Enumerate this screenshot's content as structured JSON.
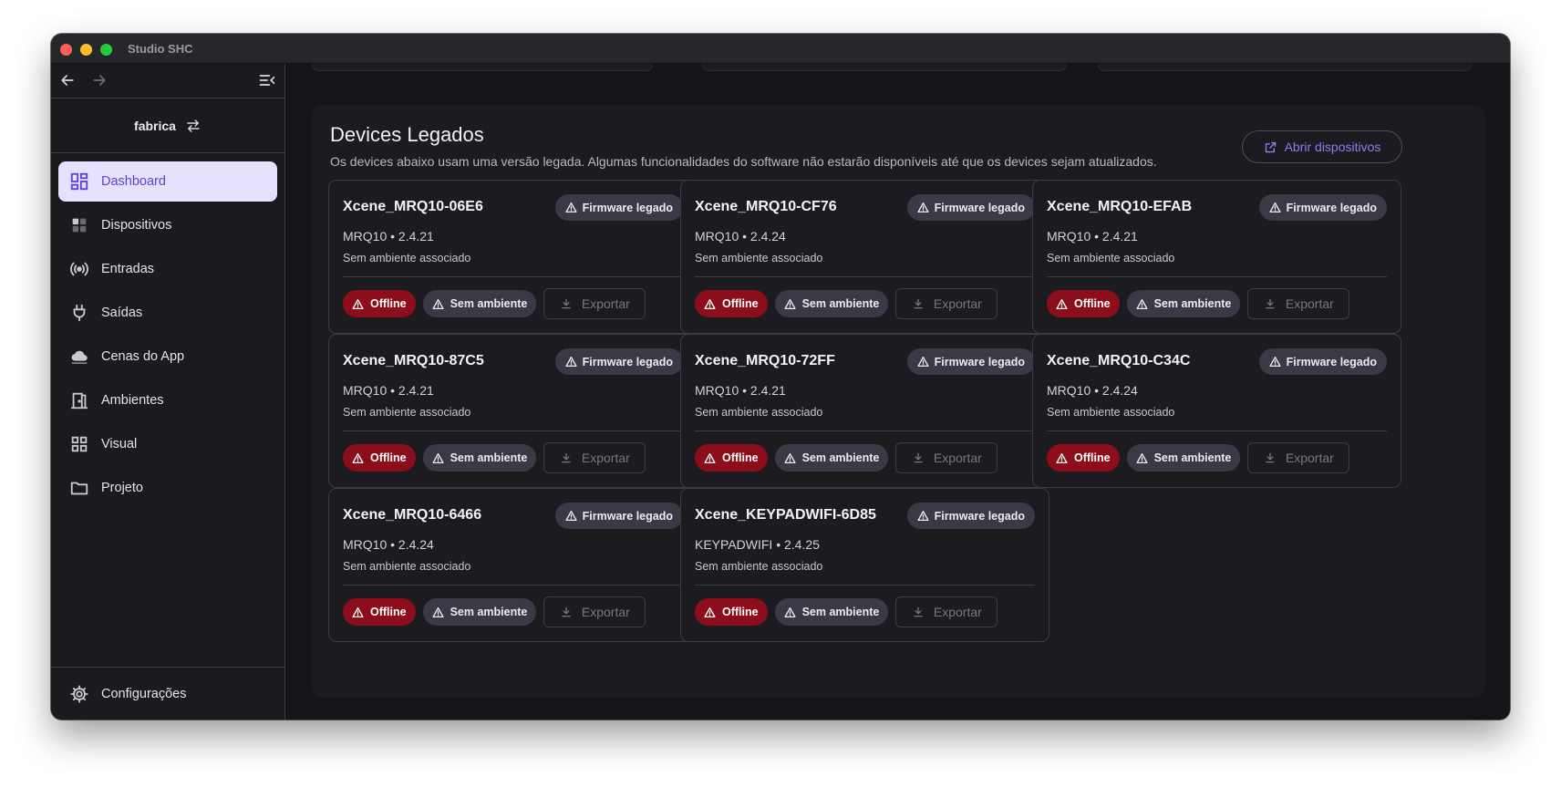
{
  "window": {
    "title": "Studio SHC"
  },
  "sidebar": {
    "project_name": "fabrica",
    "items": [
      {
        "label": "Dashboard",
        "icon": "dashboard-icon",
        "active": true
      },
      {
        "label": "Dispositivos",
        "icon": "devices-icon",
        "active": false
      },
      {
        "label": "Entradas",
        "icon": "broadcast-icon",
        "active": false
      },
      {
        "label": "Saídas",
        "icon": "plug-icon",
        "active": false
      },
      {
        "label": "Cenas do App",
        "icon": "cloud-icon",
        "active": false
      },
      {
        "label": "Ambientes",
        "icon": "door-icon",
        "active": false
      },
      {
        "label": "Visual",
        "icon": "grid-icon",
        "active": false
      },
      {
        "label": "Projeto",
        "icon": "folder-icon",
        "active": false
      }
    ],
    "settings_label": "Configurações"
  },
  "panel": {
    "title": "Devices Legados",
    "description": "Os devices abaixo usam uma versão legada. Algumas funcionalidades do software não estarão disponíveis até que os devices sejam atualizados.",
    "open_button": "Abrir dispositivos"
  },
  "labels": {
    "firmware": "Firmware legado",
    "offline": "Offline",
    "no_env": "Sem ambiente",
    "export": "Exportar",
    "no_env_assoc": "Sem ambiente associado"
  },
  "devices": [
    {
      "name": "Xcene_MRQ10-06E6",
      "model": "MRQ10 • 2.4.21"
    },
    {
      "name": "Xcene_MRQ10-CF76",
      "model": "MRQ10 • 2.4.24"
    },
    {
      "name": "Xcene_MRQ10-EFAB",
      "model": "MRQ10 • 2.4.21"
    },
    {
      "name": "Xcene_MRQ10-87C5",
      "model": "MRQ10 • 2.4.21"
    },
    {
      "name": "Xcene_MRQ10-72FF",
      "model": "MRQ10 • 2.4.21"
    },
    {
      "name": "Xcene_MRQ10-C34C",
      "model": "MRQ10 • 2.4.24"
    },
    {
      "name": "Xcene_MRQ10-6466",
      "model": "MRQ10 • 2.4.24"
    },
    {
      "name": "Xcene_KEYPADWIFI-6D85",
      "model": "KEYPADWIFI • 2.4.25"
    }
  ],
  "colors": {
    "accent": "#5a43d8",
    "accent_light": "#8e7cf4",
    "offline_red": "#8b0e1a",
    "badge_gray": "#3a3a46"
  }
}
